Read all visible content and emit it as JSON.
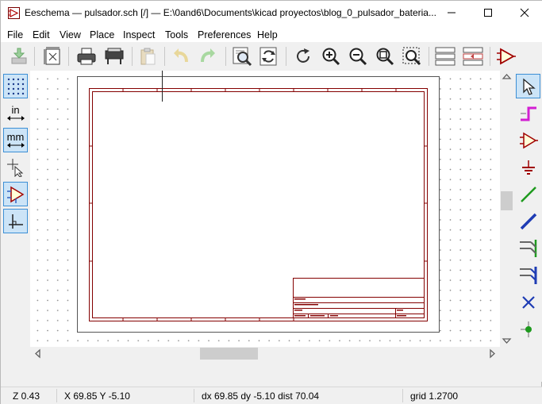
{
  "window": {
    "title": "Eeschema — pulsador.sch [/] — E:\\0and6\\Documents\\kicad proyectos\\blog_0_pulsador_bateria..."
  },
  "menu": [
    "File",
    "Edit",
    "View",
    "Place",
    "Inspect",
    "Tools",
    "Preferences",
    "Help"
  ],
  "status": {
    "zoom": "Z 0.43",
    "xy": "X 69.85  Y -5.10",
    "delta": "dx 69.85  dy -5.10  dist 70.04",
    "grid": "grid 1.2700"
  },
  "left_toolbar": {
    "units_in": "in",
    "units_mm": "mm"
  },
  "colors": {
    "sheet_border": "#840000",
    "selection_bg": "#cce4f7",
    "selection_border": "#3c8fd5"
  },
  "icons": {
    "toolbar": [
      "save-icon",
      "page-settings-icon",
      "print-icon",
      "plot-icon",
      "paste-icon",
      "undo-icon",
      "redo-icon",
      "find-icon",
      "find-replace-icon",
      "refresh-icon",
      "zoom-in-icon",
      "zoom-out-icon",
      "zoom-fit-icon",
      "zoom-selection-icon",
      "hierarchy-icon",
      "navigate-icon",
      "symbol-editor-icon"
    ],
    "left": [
      "grid-icon",
      "inches-icon",
      "millimeters-icon",
      "cursor-icon",
      "hidden-pins-icon",
      "orthogonal-icon"
    ],
    "right": [
      "select-icon",
      "highlight-net-icon",
      "add-symbol-icon",
      "add-power-icon",
      "add-wire-icon",
      "add-bus-icon",
      "wire-entry-icon",
      "bus-entry-icon",
      "no-connect-icon",
      "junction-icon"
    ]
  }
}
